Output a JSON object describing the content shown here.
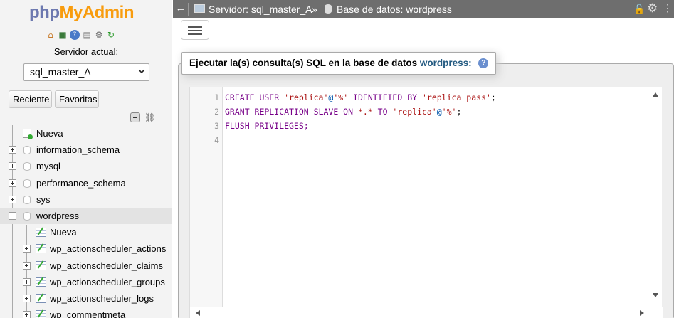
{
  "logo": {
    "php": "php",
    "myadmin": "MyAdmin"
  },
  "nav": {
    "quick_icons": [
      "home-icon",
      "exit-icon",
      "docs-icon",
      "sql-docs-icon",
      "settings-icon",
      "reload-icon"
    ],
    "server_label": "Servidor actual:",
    "server_select": "sql_master_A",
    "recent_label": "Reciente",
    "favorites_label": "Favoritas",
    "tree": [
      {
        "label": "Nueva"
      },
      {
        "label": "information_schema"
      },
      {
        "label": "mysql"
      },
      {
        "label": "performance_schema"
      },
      {
        "label": "sys"
      },
      {
        "label": "wordpress"
      },
      {
        "label": "Nueva"
      },
      {
        "label": "wp_actionscheduler_actions"
      },
      {
        "label": "wp_actionscheduler_claims"
      },
      {
        "label": "wp_actionscheduler_groups"
      },
      {
        "label": "wp_actionscheduler_logs"
      },
      {
        "label": "wp_commentmeta"
      }
    ]
  },
  "topbar": {
    "server": "Servidor: sql_master_A",
    "separator": "»",
    "database": "Base de datos: wordpress"
  },
  "query": {
    "legend_prefix": "Ejecutar la(s) consulta(s) SQL en la base de datos",
    "legend_db": "wordpress:",
    "line_numbers": [
      "1",
      "2",
      "3",
      "4"
    ],
    "lines": [
      {
        "t1": "CREATE USER ",
        "t2": "'replica'",
        "t3": "@",
        "t4": "'%'",
        "t5": " IDENTIFIED BY ",
        "t6": "'replica_pass'",
        "t7": ";"
      },
      {
        "t1": "GRANT REPLICATION SLAVE ON ",
        "t2": "*.*",
        "t3": " TO ",
        "t4": "'replica'",
        "t5": "@",
        "t6": "'%'",
        "t7": ";"
      },
      {
        "t1": "FLUSH PRIVILEGES;"
      }
    ]
  }
}
